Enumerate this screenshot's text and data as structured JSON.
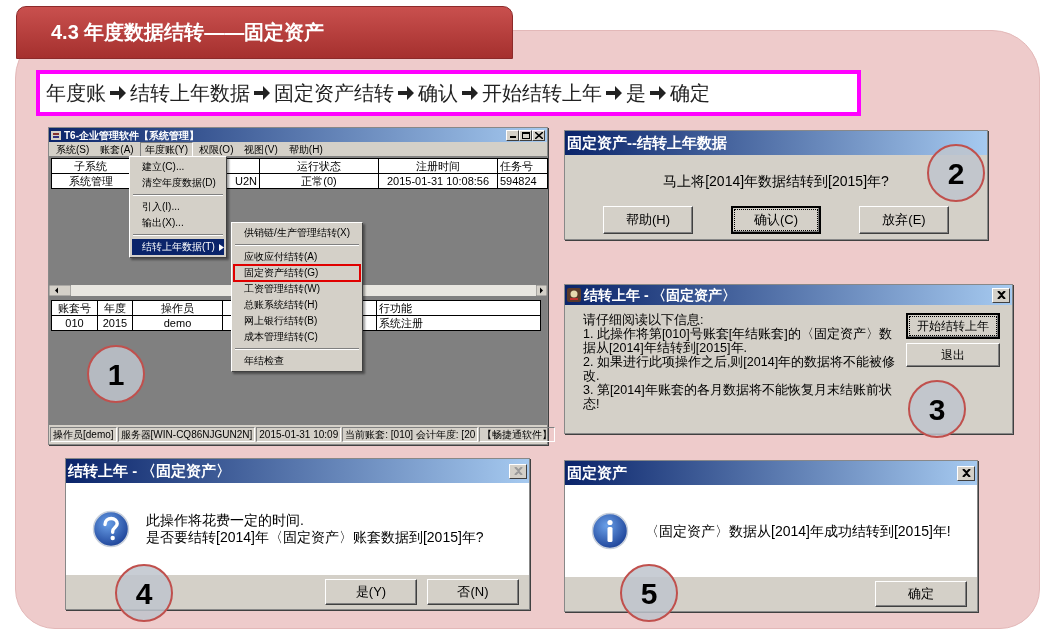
{
  "header": {
    "title": "4.3 年度数据结转——固定资产"
  },
  "path": {
    "steps": [
      "年度账",
      "结转上年数据",
      "固定资产结转",
      "确认",
      "开始结转上年",
      "是",
      "确定"
    ]
  },
  "main_window": {
    "title": "T6-企业管理软件【系统管理】",
    "step": "1",
    "menu": [
      {
        "label": "系统(S)",
        "selected": false
      },
      {
        "label": "账套(A)",
        "selected": false
      },
      {
        "label": "年度账(Y)",
        "selected": true
      },
      {
        "label": "权限(O)",
        "selected": false
      },
      {
        "label": "视图(V)",
        "selected": false
      },
      {
        "label": "帮助(H)",
        "selected": false
      }
    ],
    "upper_table": {
      "columns": [
        {
          "label": "子系统"
        },
        {},
        {
          "label": "运行状态"
        },
        {
          "label": "注册时间"
        },
        {
          "label": "任务号"
        }
      ],
      "rows": [
        [
          "系统管理",
          "U2N",
          "正常(0)",
          "2015-01-31 10:08:56",
          "594824"
        ]
      ]
    },
    "lower_table": {
      "columns": [
        {
          "label": "账套号"
        },
        {
          "label": "年度"
        },
        {
          "label": "操作员"
        },
        {},
        {
          "label": "行功能"
        }
      ],
      "rows": [
        [
          "010",
          "2015",
          "demo",
          null,
          "系统注册"
        ]
      ]
    },
    "dropdown": [
      {
        "kind": "item",
        "label": "建立(C)...",
        "selected": false
      },
      {
        "kind": "item",
        "label": "清空年度数据(D)",
        "selected": false
      },
      {
        "kind": "separator"
      },
      {
        "kind": "item",
        "label": "引入(I)...",
        "selected": false
      },
      {
        "kind": "item",
        "label": "输出(X)...",
        "selected": false
      },
      {
        "kind": "separator"
      },
      {
        "kind": "submenu",
        "label": "结转上年数据(T)",
        "selected": true
      }
    ],
    "submenu": [
      {
        "kind": "item",
        "label": "供销链/生产管理结转(X)",
        "marked": false
      },
      {
        "kind": "separator"
      },
      {
        "kind": "item",
        "label": "应收应付结转(A)",
        "marked": false
      },
      {
        "kind": "item",
        "label": "固定资产结转(G)",
        "marked": true
      },
      {
        "kind": "item",
        "label": "工资管理结转(W)",
        "marked": false
      },
      {
        "kind": "item",
        "label": "总账系统结转(H)",
        "marked": false
      },
      {
        "kind": "item",
        "label": "网上银行结转(B)",
        "marked": false
      },
      {
        "kind": "item",
        "label": "成本管理结转(C)",
        "marked": false
      },
      {
        "kind": "separator"
      },
      {
        "kind": "item",
        "label": "年结检查",
        "marked": false
      }
    ],
    "status_bar": [
      "操作员[demo]",
      "服务器[WIN-CQ86NJGUN2N]",
      "2015-01-31 10:09",
      "当前账套: [010] 会计年度: [20",
      "【畅捷通软件】"
    ]
  },
  "confirm_dialog": {
    "title": "固定资产--结转上年数据",
    "step": "2",
    "message": "马上将[2014]年数据结转到[2015]年?",
    "buttons": [
      {
        "label": "帮助(H)",
        "focused": false
      },
      {
        "label": "确认(C)",
        "focused": true
      },
      {
        "label": "放弃(E)",
        "focused": false
      }
    ]
  },
  "notice_dialog": {
    "title": "结转上年 - 〈固定资产〉",
    "step": "3",
    "close": {
      "disabled": false
    },
    "lines": [
      "请仔细阅读以下信息:",
      "1. 此操作将第[010]号账套[年结账套]的〈固定资产〉数据从[2014]年结转到[2015]年.",
      "2. 如果进行此项操作之后,则[2014]年的数据将不能被修改.",
      "3. 第[2014]年账套的各月数据将不能恢复月末结账前状态!"
    ],
    "buttons": [
      {
        "label": "开始结转上年",
        "focused": true
      },
      {
        "label": "退出",
        "focused": false
      }
    ]
  },
  "question_dialog": {
    "title": "结转上年 - 〈固定资产〉",
    "step": "4",
    "close": {
      "disabled": true
    },
    "lines": [
      "此操作将花费一定的时间.",
      "是否要结转[2014]年〈固定资产〉账套数据到[2015]年?"
    ],
    "buttons": [
      {
        "label": "是(Y)",
        "focused": false
      },
      {
        "label": "否(N)",
        "focused": false
      }
    ]
  },
  "info_dialog": {
    "title": "固定资产",
    "step": "5",
    "close": {
      "disabled": false
    },
    "lines": [
      "〈固定资产〉数据从[2014]年成功结转到[2015]年!"
    ],
    "buttons": [
      {
        "label": "确定",
        "focused": false
      }
    ]
  }
}
